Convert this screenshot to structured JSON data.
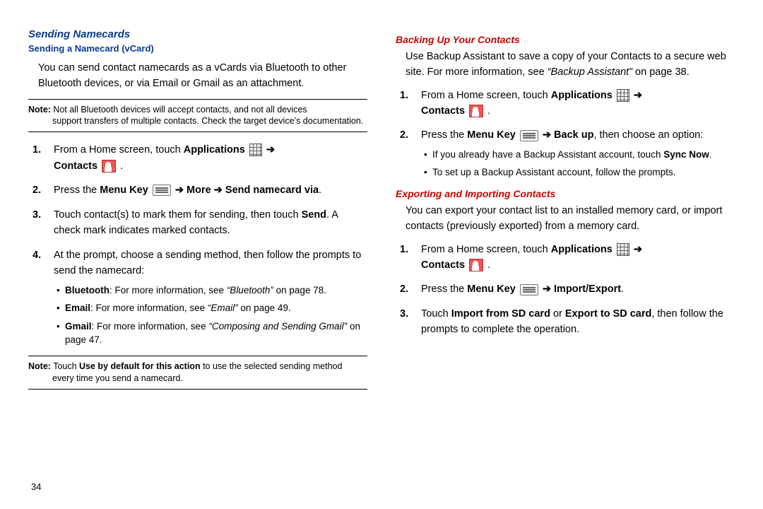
{
  "page_number": "34",
  "left": {
    "h3": "Sending Namecards",
    "h5": "Sending a Namecard (vCard)",
    "intro": "You can send contact namecards as a vCards via Bluetooth to other Bluetooth devices, or via Email or Gmail as an attachment.",
    "note1_label": "Note:",
    "note1_first": " Not all Bluetooth devices will accept contacts, and not all devices",
    "note1_rest": "support transfers of multiple contacts. Check the target device’s documentation.",
    "step1_a": "From a Home screen, touch ",
    "step1_apps": "Applications",
    "step1_contacts": "Contacts",
    "arrow": " ➔ ",
    "period": " .",
    "step2_a": "Press the ",
    "step2_menu": "Menu Key",
    "step2_more": "More",
    "step2_send": "Send namecard via",
    "step3_a": "Touch contact(s) to mark them for sending, then touch ",
    "step3_send": "Send",
    "step3_b": ". A check mark indicates marked contacts.",
    "step4": "At the prompt, choose a sending method, then follow the prompts to send the namecard:",
    "sub_bt_b": "Bluetooth",
    "sub_bt_t": ": For more information, see ",
    "sub_bt_i": "“Bluetooth”",
    "sub_bt_p": " on page 78.",
    "sub_em_b": "Email",
    "sub_em_t": ": For more information, see ",
    "sub_em_i": "“Email”",
    "sub_em_p": " on page 49.",
    "sub_gm_b": "Gmail",
    "sub_gm_t": ": For more information, see ",
    "sub_gm_i": "“Composing and Sending Gmail”",
    "sub_gm_p": " on page 47.",
    "note2_label": "Note:",
    "note2_a": " Touch ",
    "note2_b": "Use by default for this action",
    "note2_c": " to use the selected sending method",
    "note2_rest": "every time you send a namecard."
  },
  "right": {
    "h4a": "Backing Up Your Contacts",
    "backup_a": "Use Backup Assistant to save a copy of your Contacts to a secure web site. For more information, see ",
    "backup_i": "“Backup Assistant”",
    "backup_b": " on page 38.",
    "r1_a": "From a Home screen, touch ",
    "r1_apps": "Applications",
    "r1_contacts": "Contacts",
    "r2_a": "Press the ",
    "r2_menu": "Menu Key",
    "r2_backup": "Back up",
    "r2_b": ", then choose an option:",
    "rsub1_a": "If you already have a Backup Assistant account, touch ",
    "rsub1_b": "Sync Now",
    "rsub1_c": ".",
    "rsub2": "To set up a Backup Assistant account, follow the prompts.",
    "h4b": "Exporting and Importing Contacts",
    "exp_intro": "You can export your contact list to an installed memory card, or import contacts (previously exported) from a memory card.",
    "e1_a": "From a Home screen, touch ",
    "e1_apps": "Applications",
    "e1_contacts": "Contacts",
    "e2_a": "Press the ",
    "e2_menu": "Menu Key",
    "e2_ie": "Import/Export",
    "e3_a": "Touch ",
    "e3_b1": "Import from SD card",
    "e3_or": " or ",
    "e3_b2": "Export to SD card",
    "e3_c": ", then follow the prompts to complete the operation."
  }
}
